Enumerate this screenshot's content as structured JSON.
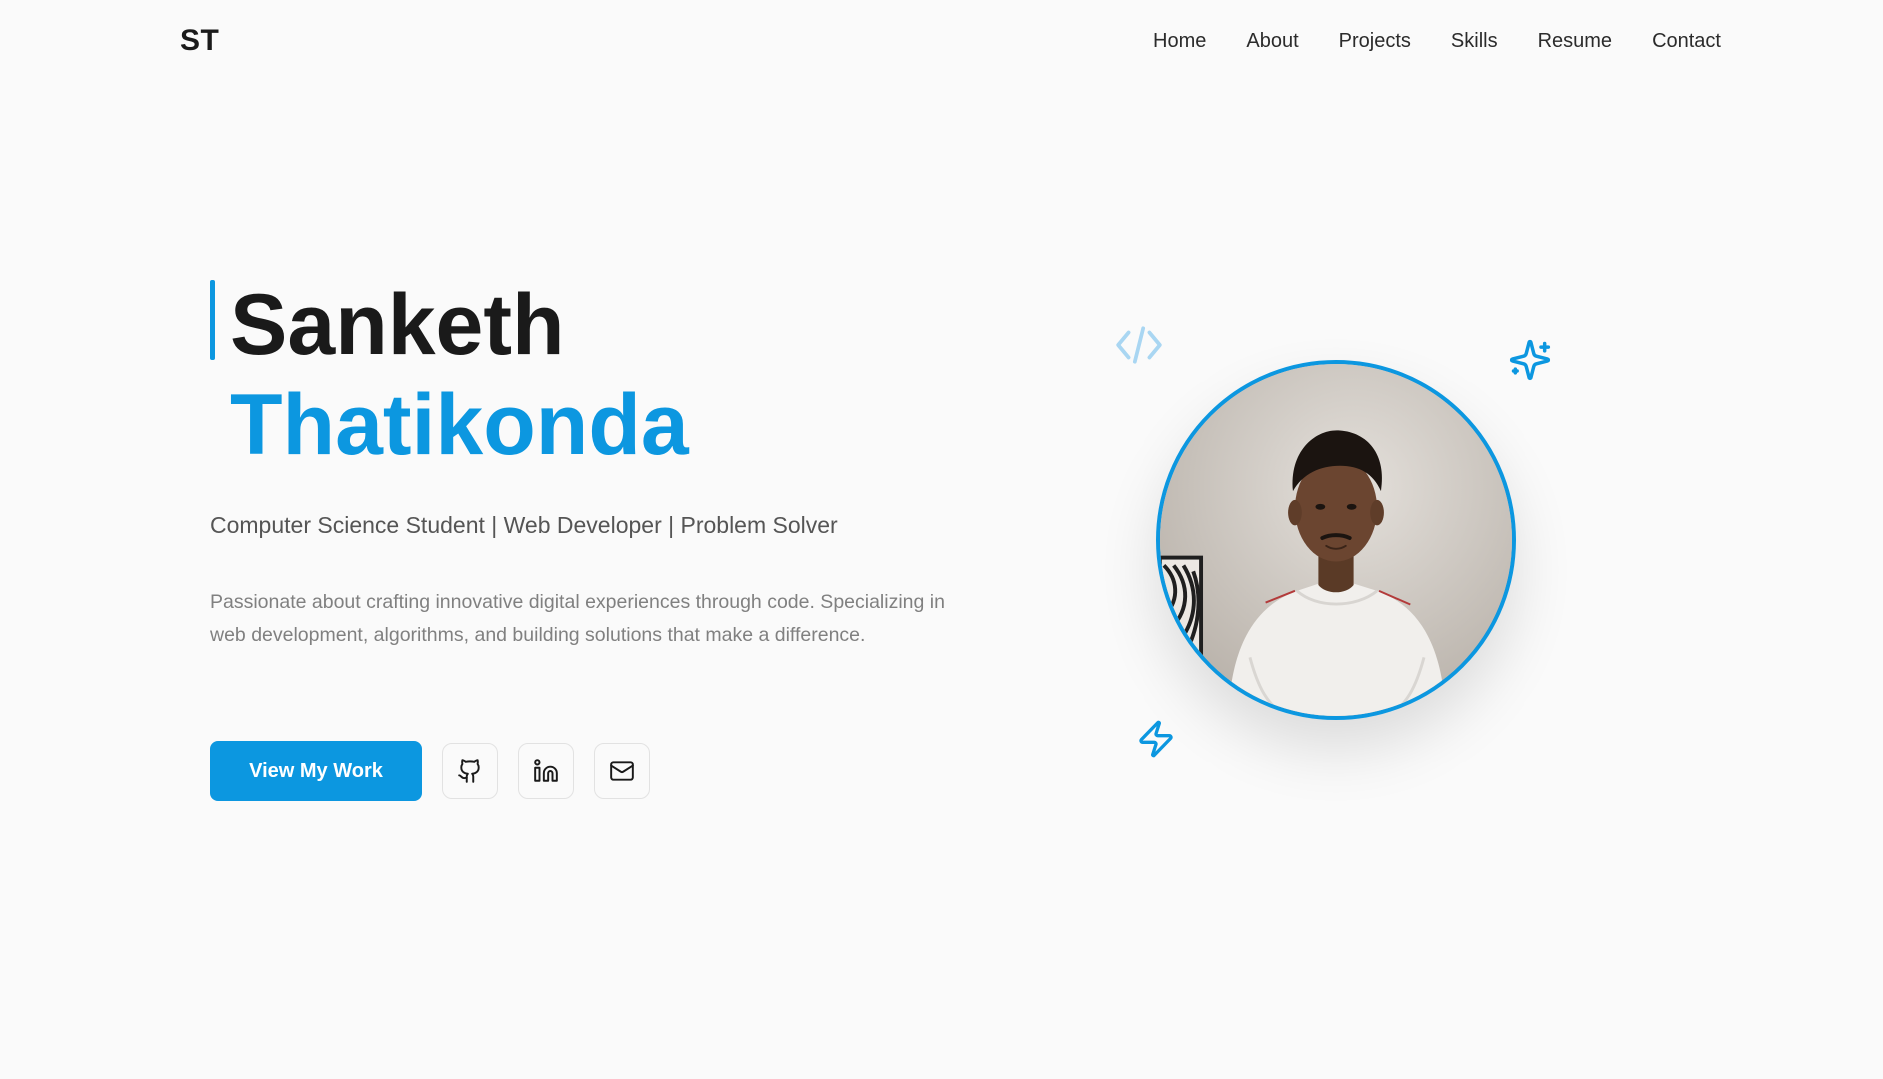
{
  "nav": {
    "logo": "ST",
    "links": [
      {
        "label": "Home"
      },
      {
        "label": "About"
      },
      {
        "label": "Projects"
      },
      {
        "label": "Skills"
      },
      {
        "label": "Resume"
      },
      {
        "label": "Contact"
      }
    ]
  },
  "hero": {
    "first_name": "Sanketh",
    "last_name": "Thatikonda",
    "tagline": "Computer Science Student | Web Developer | Problem Solver",
    "description": "Passionate about crafting innovative digital experiences through code. Specializing in web development, algorithms, and building solutions that make a difference.",
    "cta_label": "View My Work",
    "social_icons": [
      "github-icon",
      "linkedin-icon",
      "mail-icon"
    ]
  },
  "decorations": {
    "icons": [
      "code-brackets-icon",
      "sparkles-icon",
      "lightning-icon"
    ]
  },
  "colors": {
    "accent": "#0c97e0",
    "background": "#fafafa",
    "heading": "#1a1a1a",
    "muted_text": "#808080"
  }
}
